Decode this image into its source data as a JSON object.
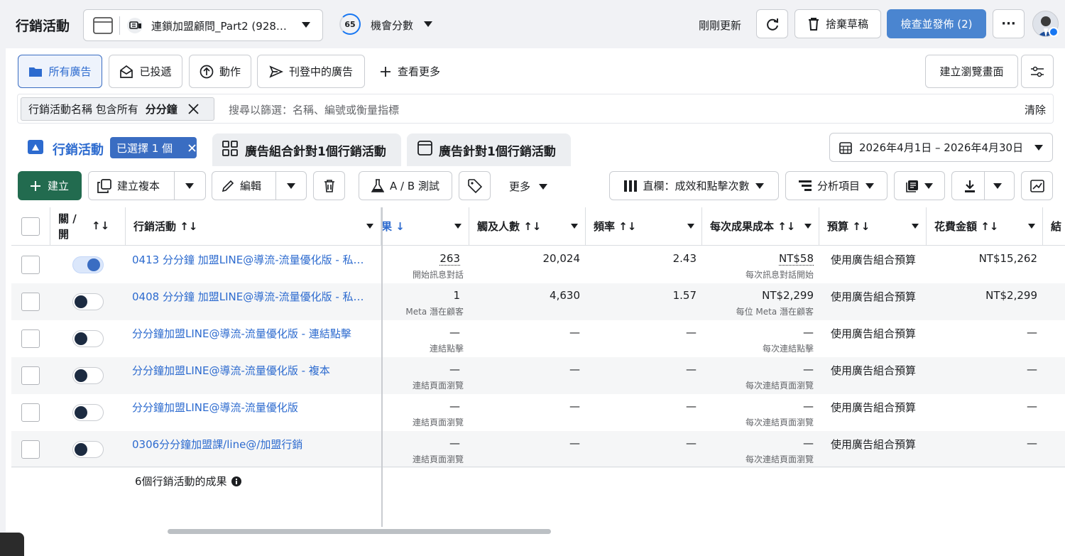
{
  "top": {
    "title": "行銷活動",
    "account_name": "連鎖加盟顧問_Part2 (928…",
    "score_value": "65",
    "score_label": "機會分數",
    "updated_text": "剛剛更新",
    "discard_label": "捨棄草稿",
    "publish_label": "檢查並發佈 (2)"
  },
  "quickfilters": {
    "all_ads": "所有廣告",
    "delivered": "已投遞",
    "actions": "動作",
    "active": "刊登中的廣告",
    "more": "查看更多",
    "create_view": "建立瀏覽畫面"
  },
  "filter": {
    "chip_prefix": "行銷活動名稱 包含所有",
    "chip_value": "分分鐘",
    "placeholder": "搜尋以篩選：名稱、編號或衡量指標",
    "clear_label": "清除"
  },
  "tabs": {
    "campaigns": "行銷活動",
    "selected_badge": "已選擇 1 個",
    "adsets": "廣告組合針對1個行銷活動",
    "ads": "廣告針對1個行銷活動"
  },
  "date_range": "2026年4月1日 – 2026年4月30日",
  "toolbar": {
    "create": "建立",
    "duplicate": "建立複本",
    "edit": "編輯",
    "ab_test": "A / B 測試",
    "more": "更多",
    "columns": "直欄：成效和點擊次數",
    "breakdown": "分析項目"
  },
  "columns": {
    "toggle": "關 /\n開",
    "name": "行銷活動 ↑↓",
    "results": "果 ↓",
    "reach": "觸及人數 ↑↓",
    "frequency": "頻率 ↑↓",
    "cpr": "每次成果成本 ↑↓",
    "budget": "預算 ↑↓",
    "spend": "花費金額 ↑↓",
    "next": "結"
  },
  "rows": [
    {
      "name": "0413 分分鐘 加盟LINE@導流-流量優化版 - 私…",
      "on": true,
      "results": "263",
      "results_sub": "開始訊息對話",
      "reach": "20,024",
      "frequency": "2.43",
      "cpr": "NT$58",
      "cpr_sub": "每次訊息對話開始",
      "budget": "使用廣告組合預算",
      "spend": "NT$15,262"
    },
    {
      "name": "0408 分分鐘 加盟LINE@導流-流量優化版 - 私…",
      "on": false,
      "results": "1",
      "results_sub": "Meta 潛在顧客",
      "reach": "4,630",
      "frequency": "1.57",
      "cpr": "NT$2,299",
      "cpr_sub": "每位 Meta 潛在顧客",
      "budget": "使用廣告組合預算",
      "spend": "NT$2,299"
    },
    {
      "name": "分分鐘加盟LINE@導流-流量優化版 - 連結點擊",
      "on": false,
      "results": "—",
      "results_sub": "連結點擊",
      "reach": "—",
      "frequency": "—",
      "cpr": "—",
      "cpr_sub": "每次連結點擊",
      "budget": "使用廣告組合預算",
      "spend": "—"
    },
    {
      "name": "分分鐘加盟LINE@導流-流量優化版 - 複本",
      "on": false,
      "results": "—",
      "results_sub": "連結頁面瀏覽",
      "reach": "—",
      "frequency": "—",
      "cpr": "—",
      "cpr_sub": "每次連結頁面瀏覽",
      "budget": "使用廣告組合預算",
      "spend": "—"
    },
    {
      "name": "分分鐘加盟LINE@導流-流量優化版",
      "on": false,
      "results": "—",
      "results_sub": "連結頁面瀏覽",
      "reach": "—",
      "frequency": "—",
      "cpr": "—",
      "cpr_sub": "每次連結頁面瀏覽",
      "budget": "使用廣告組合預算",
      "spend": "—"
    },
    {
      "name": "0306分分鐘加盟課/line@/加盟行銷",
      "on": false,
      "results": "—",
      "results_sub": "連結頁面瀏覽",
      "reach": "—",
      "frequency": "—",
      "cpr": "—",
      "cpr_sub": "每次連結頁面瀏覽",
      "budget": "使用廣告組合預算",
      "spend": "—"
    }
  ],
  "summary": "6個行銷活動的成果"
}
